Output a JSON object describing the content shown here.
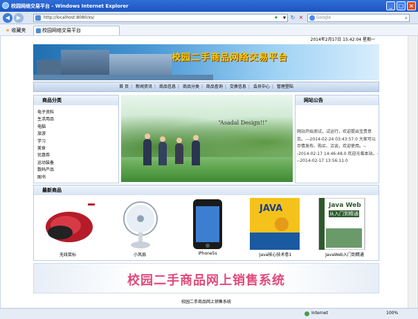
{
  "window": {
    "title": "校园网络交易平台 - Windows Internet Explorer",
    "min_glyph": "_",
    "max_glyph": "□",
    "close_glyph": "×"
  },
  "addressbar": {
    "url": "http://localhost:8080/xs/",
    "search_placeholder": "Google",
    "back_glyph": "◀",
    "forward_glyph": "▶"
  },
  "favorites": {
    "label": "收藏夹",
    "tab_title": "校园网络交易平台"
  },
  "page": {
    "datetime": "2014年2月17日  15:42:04    星期一",
    "banner_title": "校园二手商品网络交易平台",
    "menu": [
      "首 页",
      "新闻资讯",
      "商品信息",
      "商品分类",
      "商品查询",
      "交换信息",
      "会员中心",
      "管理登陆"
    ],
    "category_heading": "商品分类",
    "categories": [
      "电子资料",
      "生活用品",
      "电脑",
      "旅游",
      "学习",
      "美食",
      "优惠券",
      "运动装备",
      "数码产品",
      "图书"
    ],
    "photo_caption": "“Asadal Design!!”",
    "news_heading": "网站公告",
    "news_text": "网站开始测试，试运行，欢迎提出宝贵意见。---2014-02-24 03:43:57.0 大家可以尽情发布、购买、洽谈，欢迎使用。---2014-02-17 14:46:48.0 欢迎光临本站。---2014-02-17 13:56:11.0",
    "products_heading": "最新商品",
    "products": [
      {
        "name": "无线鼠标",
        "icon": "mouse-icon"
      },
      {
        "name": "小风扇",
        "icon": "fan-icon"
      },
      {
        "name": "iPhone5s",
        "icon": "phone-icon"
      },
      {
        "name": "Java核心技术卷1",
        "icon": "book-icon"
      },
      {
        "name": "JavaWeb入门到精通",
        "icon": "book-icon"
      }
    ],
    "book1_cover": "JAVA",
    "book2_cover": "Java Web",
    "book2_sub": "从入门到精通",
    "footer_banner": "校园二手商品网上销售系统",
    "footer": "校园二手商品网上销售系统"
  },
  "statusbar": {
    "zone": "Internet",
    "zoom": "100%"
  },
  "colors": {
    "titlebar": "#1d54c1",
    "banner_title": "#ffcc00",
    "footer_banner_text": "#e04a7a",
    "box_border": "#b7cbe2"
  }
}
